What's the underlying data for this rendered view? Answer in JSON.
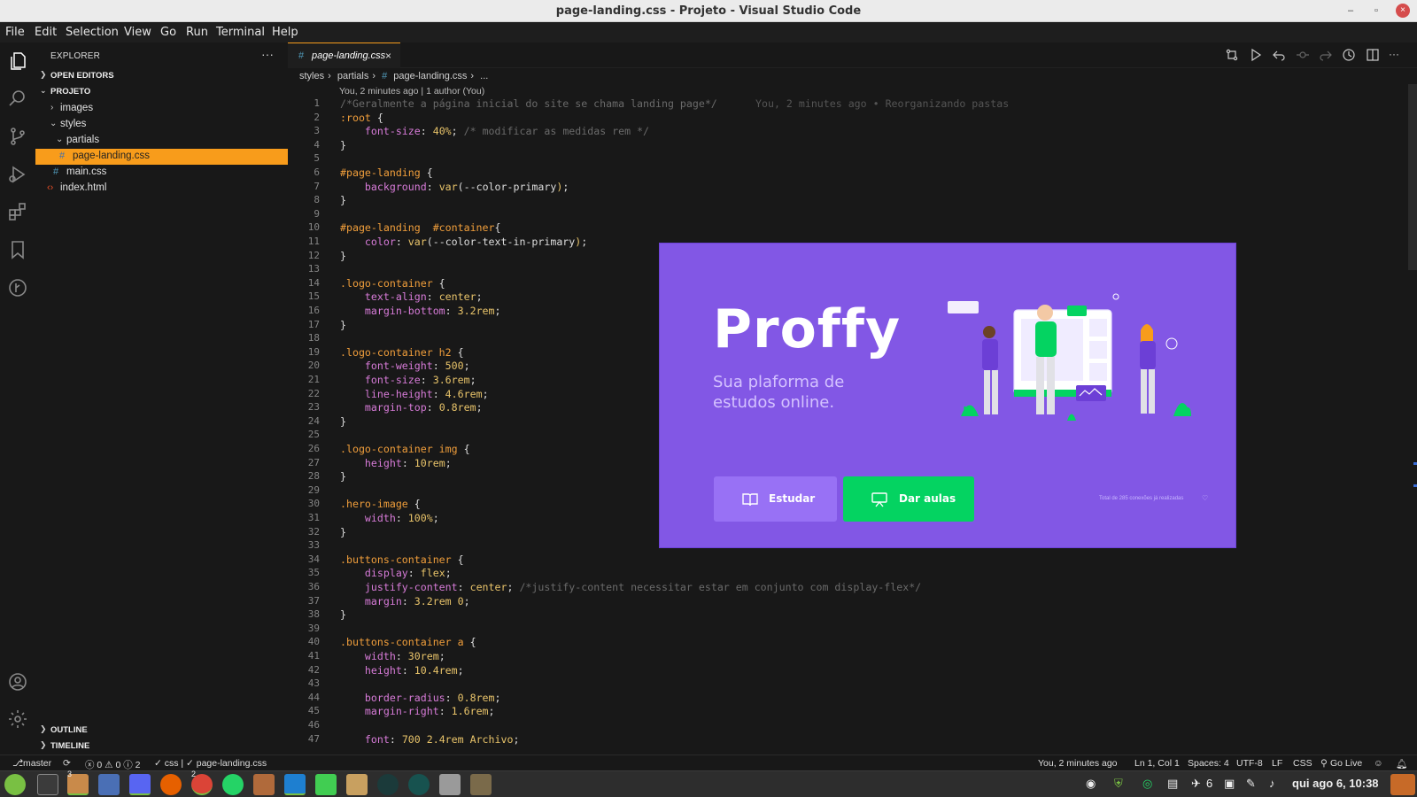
{
  "window": {
    "title": "page-landing.css - Projeto - Visual Studio Code",
    "minimize": "–",
    "restore": "▫",
    "close": "×"
  },
  "menu": [
    "File",
    "Edit",
    "Selection",
    "View",
    "Go",
    "Run",
    "Terminal",
    "Help"
  ],
  "sidebar": {
    "header": "EXPLORER",
    "more": "···",
    "open_editors": "OPEN EDITORS",
    "project": "PROJETO",
    "tree": [
      {
        "label": "images",
        "type": "folder",
        "expanded": false
      },
      {
        "label": "styles",
        "type": "folder",
        "expanded": true
      },
      {
        "label": "partials",
        "type": "folder",
        "expanded": true
      },
      {
        "label": "page-landing.css",
        "type": "css",
        "active": true
      },
      {
        "label": "main.css",
        "type": "css"
      },
      {
        "label": "index.html",
        "type": "html"
      }
    ],
    "outline": "OUTLINE",
    "timeline": "TIMELINE"
  },
  "tab": {
    "hash": "#",
    "name": "page-landing.css",
    "close": "×"
  },
  "breadcrumb": {
    "parts": [
      "styles",
      "partials",
      "page-landing.css",
      "..."
    ],
    "sep": "›",
    "hash": "#"
  },
  "codelens": "You, 2 minutes ago | 1 author (You)",
  "blame": "You, 2 minutes ago • Reorganizando pastas",
  "code_lines": [
    [
      [
        "cmt",
        "/*Geralmente a página inicial do site se chama landing page*/"
      ]
    ],
    [
      [
        "sel",
        ":root"
      ],
      [
        "plain",
        " {"
      ]
    ],
    [
      [
        "plain",
        "    "
      ],
      [
        "prop",
        "font-size"
      ],
      [
        "plain",
        ": "
      ],
      [
        "val",
        "40%"
      ],
      [
        "plain",
        "; "
      ],
      [
        "cmt",
        "/* modificar as medidas rem */"
      ]
    ],
    [
      [
        "plain",
        "}"
      ]
    ],
    [],
    [
      [
        "sel",
        "#page-landing"
      ],
      [
        "plain",
        " {"
      ]
    ],
    [
      [
        "plain",
        "    "
      ],
      [
        "prop",
        "background"
      ],
      [
        "plain",
        ": "
      ],
      [
        "val",
        "var"
      ],
      [
        "plain",
        "(--color-primary"
      ],
      [
        "val",
        ")"
      ],
      [
        "plain",
        ";"
      ]
    ],
    [
      [
        "plain",
        "}"
      ]
    ],
    [],
    [
      [
        "sel",
        "#page-landing  #container"
      ],
      [
        "plain",
        "{"
      ]
    ],
    [
      [
        "plain",
        "    "
      ],
      [
        "prop",
        "color"
      ],
      [
        "plain",
        ": "
      ],
      [
        "val",
        "var"
      ],
      [
        "plain",
        "(--color-text-in-primary"
      ],
      [
        "val",
        ")"
      ],
      [
        "plain",
        ";"
      ]
    ],
    [
      [
        "plain",
        "}"
      ]
    ],
    [],
    [
      [
        "sel",
        ".logo-container"
      ],
      [
        "plain",
        " {"
      ]
    ],
    [
      [
        "plain",
        "    "
      ],
      [
        "prop",
        "text-align"
      ],
      [
        "plain",
        ": "
      ],
      [
        "val",
        "center"
      ],
      [
        "plain",
        ";"
      ]
    ],
    [
      [
        "plain",
        "    "
      ],
      [
        "prop",
        "margin-bottom"
      ],
      [
        "plain",
        ": "
      ],
      [
        "val",
        "3.2rem"
      ],
      [
        "plain",
        ";"
      ]
    ],
    [
      [
        "plain",
        "}"
      ]
    ],
    [],
    [
      [
        "sel",
        ".logo-container h2"
      ],
      [
        "plain",
        " {"
      ]
    ],
    [
      [
        "plain",
        "    "
      ],
      [
        "prop",
        "font-weight"
      ],
      [
        "plain",
        ": "
      ],
      [
        "val",
        "500"
      ],
      [
        "plain",
        ";"
      ]
    ],
    [
      [
        "plain",
        "    "
      ],
      [
        "prop",
        "font-size"
      ],
      [
        "plain",
        ": "
      ],
      [
        "val",
        "3.6rem"
      ],
      [
        "plain",
        ";"
      ]
    ],
    [
      [
        "plain",
        "    "
      ],
      [
        "prop",
        "line-height"
      ],
      [
        "plain",
        ": "
      ],
      [
        "val",
        "4.6rem"
      ],
      [
        "plain",
        ";"
      ]
    ],
    [
      [
        "plain",
        "    "
      ],
      [
        "prop",
        "margin-top"
      ],
      [
        "plain",
        ": "
      ],
      [
        "val",
        "0.8rem"
      ],
      [
        "plain",
        ";"
      ]
    ],
    [
      [
        "plain",
        "}"
      ]
    ],
    [],
    [
      [
        "sel",
        ".logo-container img"
      ],
      [
        "plain",
        " {"
      ]
    ],
    [
      [
        "plain",
        "    "
      ],
      [
        "prop",
        "height"
      ],
      [
        "plain",
        ": "
      ],
      [
        "val",
        "10rem"
      ],
      [
        "plain",
        ";"
      ]
    ],
    [
      [
        "plain",
        "}"
      ]
    ],
    [],
    [
      [
        "sel",
        ".hero-image"
      ],
      [
        "plain",
        " {"
      ]
    ],
    [
      [
        "plain",
        "    "
      ],
      [
        "prop",
        "width"
      ],
      [
        "plain",
        ": "
      ],
      [
        "val",
        "100%"
      ],
      [
        "plain",
        ";"
      ]
    ],
    [
      [
        "plain",
        "}"
      ]
    ],
    [],
    [
      [
        "sel",
        ".buttons-container"
      ],
      [
        "plain",
        " {"
      ]
    ],
    [
      [
        "plain",
        "    "
      ],
      [
        "prop",
        "display"
      ],
      [
        "plain",
        ": "
      ],
      [
        "val",
        "flex"
      ],
      [
        "plain",
        ";"
      ]
    ],
    [
      [
        "plain",
        "    "
      ],
      [
        "prop",
        "justify-content"
      ],
      [
        "plain",
        ": "
      ],
      [
        "val",
        "center"
      ],
      [
        "plain",
        "; "
      ],
      [
        "cmt",
        "/*justify-content necessitar estar em conjunto com display-flex*/"
      ]
    ],
    [
      [
        "plain",
        "    "
      ],
      [
        "prop",
        "margin"
      ],
      [
        "plain",
        ": "
      ],
      [
        "val",
        "3.2rem 0"
      ],
      [
        "plain",
        ";"
      ]
    ],
    [
      [
        "plain",
        "}"
      ]
    ],
    [],
    [
      [
        "sel",
        ".buttons-container a"
      ],
      [
        "plain",
        " {"
      ]
    ],
    [
      [
        "plain",
        "    "
      ],
      [
        "prop",
        "width"
      ],
      [
        "plain",
        ": "
      ],
      [
        "val",
        "30rem"
      ],
      [
        "plain",
        ";"
      ]
    ],
    [
      [
        "plain",
        "    "
      ],
      [
        "prop",
        "height"
      ],
      [
        "plain",
        ": "
      ],
      [
        "val",
        "10.4rem"
      ],
      [
        "plain",
        ";"
      ]
    ],
    [],
    [
      [
        "plain",
        "    "
      ],
      [
        "prop",
        "border-radius"
      ],
      [
        "plain",
        ": "
      ],
      [
        "val",
        "0.8rem"
      ],
      [
        "plain",
        ";"
      ]
    ],
    [
      [
        "plain",
        "    "
      ],
      [
        "prop",
        "margin-right"
      ],
      [
        "plain",
        ": "
      ],
      [
        "val",
        "1.6rem"
      ],
      [
        "plain",
        ";"
      ]
    ],
    [],
    [
      [
        "plain",
        "    "
      ],
      [
        "prop",
        "font"
      ],
      [
        "plain",
        ": "
      ],
      [
        "val",
        "700 2.4rem Archivo"
      ],
      [
        "plain",
        ";"
      ]
    ]
  ],
  "preview": {
    "logo": "Proffy",
    "tagline": "Sua plaforma de estudos online.",
    "study_button": "Estudar",
    "teach_button": "Dar aulas",
    "total": "Total de 285 conexões já realizadas",
    "heart": "♡",
    "colors": {
      "bg": "#8257e5",
      "study": "#9871f5",
      "teach": "#04d361"
    }
  },
  "status": {
    "branch": "master",
    "sync": "⟳",
    "problems": "ⓧ 0 ⚠ 0 ⓘ 2",
    "lint": "✓ css | ✓ page-landing.css",
    "blame": "You, 2 minutes ago",
    "position": "Ln 1, Col 1",
    "spaces": "Spaces: 4",
    "encoding": "UTF-8",
    "eol": "LF",
    "language": "CSS",
    "golive": "Go Live"
  },
  "taskbar": {
    "clock": "qui ago 6, 10:38",
    "badge1": "3",
    "badge2": "2",
    "notif_count": "6"
  }
}
